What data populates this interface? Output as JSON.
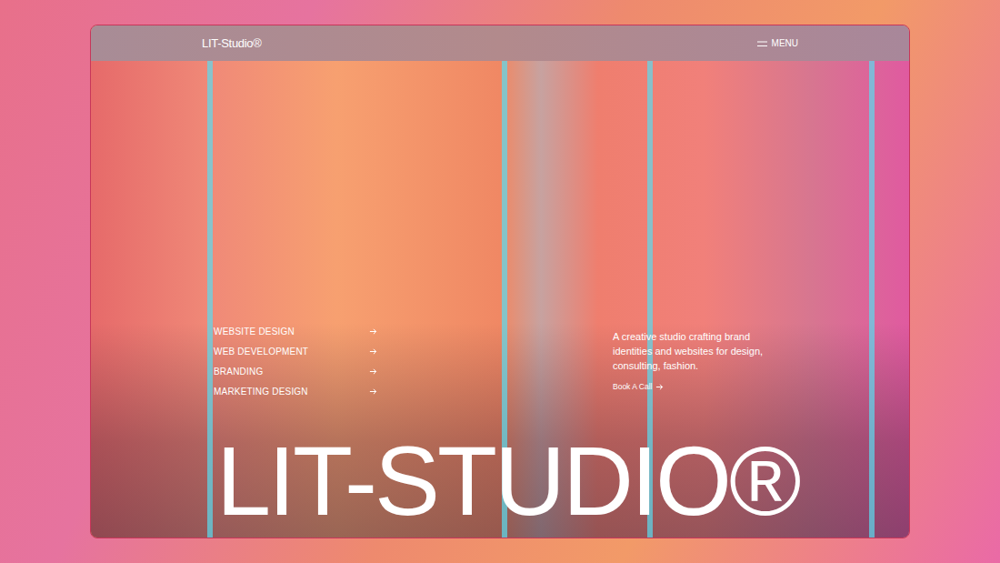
{
  "header": {
    "logo": "LIT-Studio®",
    "menu": {
      "label": "MENU"
    }
  },
  "services": [
    {
      "label": "WEBSITE DESIGN"
    },
    {
      "label": "WEB DEVELOPMENT"
    },
    {
      "label": "BRANDING"
    },
    {
      "label": "MARKETING DESIGN"
    }
  ],
  "description": "A creative studio crafting brand identities and websites for design, consulting, fashion.",
  "cta": {
    "label": "Book A Call"
  },
  "hero_title": "LIT-STUDIO®"
}
